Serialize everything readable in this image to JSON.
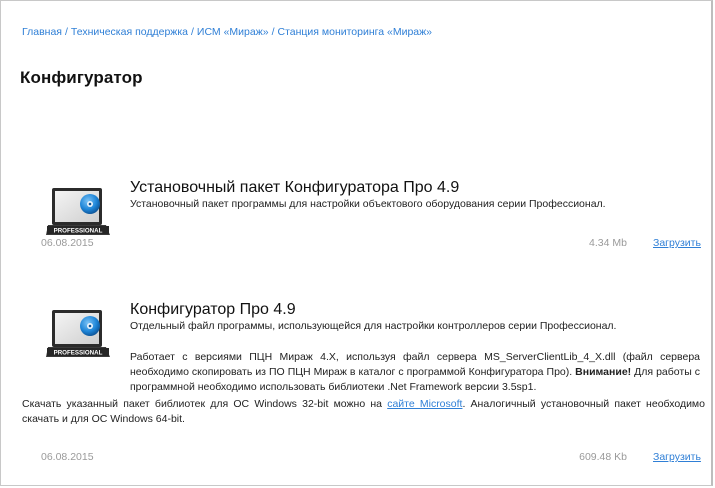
{
  "breadcrumb": {
    "items": [
      "Главная",
      "Техническая поддержка",
      "ИСМ «Мираж»",
      "Станция мониторинга «Мираж»"
    ],
    "separator": "/"
  },
  "page": {
    "title": "Конфигуратор"
  },
  "icon": {
    "name": "professional-software-icon",
    "label": "PROFESSIONAL",
    "disc_color": "#1f86d8"
  },
  "items": [
    {
      "title": "Установочный пакет Конфигуратора Про 4.9",
      "description": "Установочный пакет программы для настройки объектового оборудования серии Профессионал.",
      "date": "06.08.2015",
      "size": "4.34 Mb",
      "download_label": "Загрузить"
    },
    {
      "title": "Конфигуратор Про 4.9",
      "description": "Отдельный файл программы, использующейся для настройки контроллеров серии Профессионал.",
      "para1": "Работает с версиями ПЦН Мираж 4.X, используя файл сервера MS_ServerClientLib_4_X.dll (файл сервера необходимо скопировать из ПО ПЦН Мираж в каталог с программой Конфигуратора Про).",
      "attention_label": "Внимание!",
      "attention_text": " Для работы с программной необходимо использовать библиотеки .Net Framework версии 3.5sp1.",
      "para2_before": "Скачать указанный пакет библиотек для ОС Windows 32-bit можно на ",
      "para2_link": "сайте Microsoft",
      "para2_after": ". Аналогичный установочный пакет необходимо скачать и для ОС Windows 64-bit.",
      "date": "06.08.2015",
      "size": "609.48 Kb",
      "download_label": "Загрузить"
    }
  ],
  "colors": {
    "link": "#2f7fd6",
    "meta": "#9a9a9a"
  }
}
